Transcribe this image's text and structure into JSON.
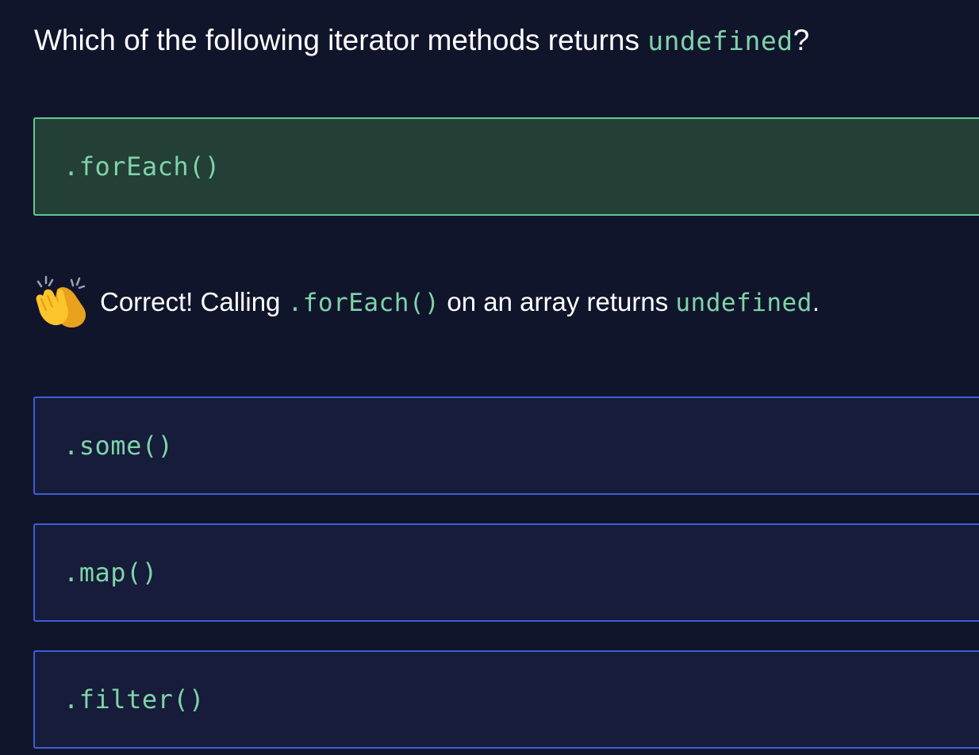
{
  "question": {
    "prefix": "Which of the following iterator methods returns ",
    "code": "undefined",
    "suffix": "?"
  },
  "options": [
    {
      "label": ".forEach()",
      "state": "correct"
    },
    {
      "label": ".some()",
      "state": "default"
    },
    {
      "label": ".map()",
      "state": "default"
    },
    {
      "label": ".filter()",
      "state": "default"
    }
  ],
  "feedback": {
    "icon": "clapping-hands-icon",
    "prefix": "Correct! Calling ",
    "code1": ".forEach()",
    "middle": " on an array returns ",
    "code2": "undefined",
    "suffix": "."
  },
  "colors": {
    "background": "#11152b",
    "code_text": "#7fd3aa",
    "correct_bg": "#233f36",
    "correct_border": "#63c795",
    "option_bg": "#161c39",
    "option_border": "#3a5fd6"
  }
}
